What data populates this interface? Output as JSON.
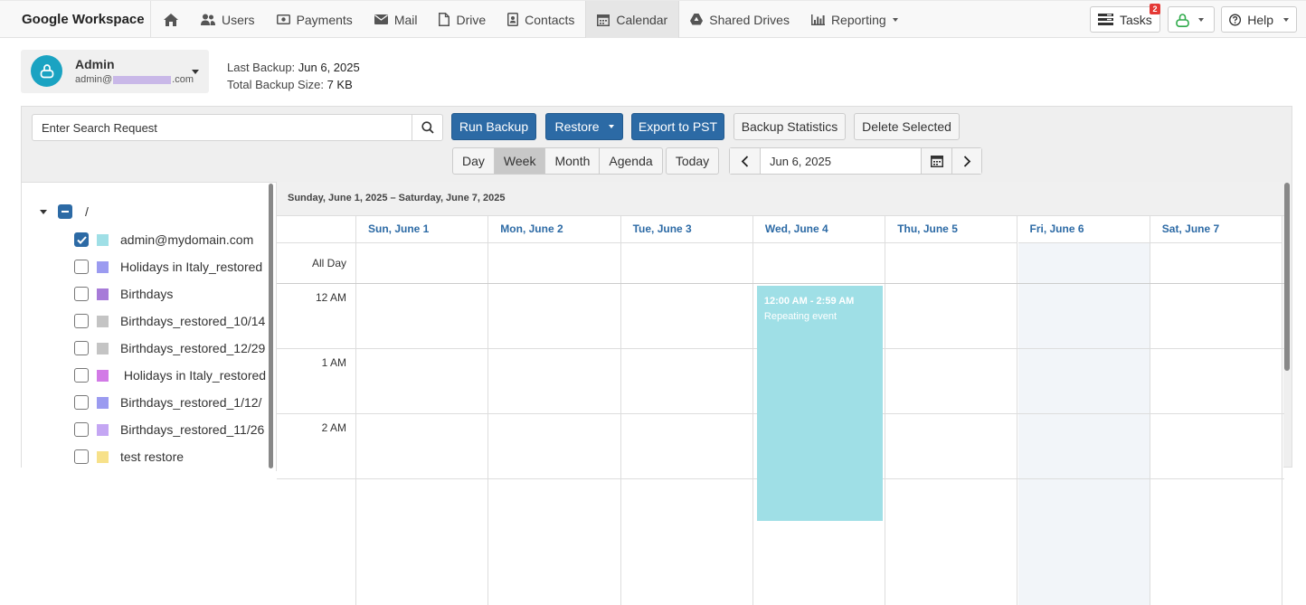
{
  "nav": {
    "brand": "Google Workspace",
    "items": [
      {
        "label": "",
        "icon": "home-icon"
      },
      {
        "label": "Users",
        "icon": "users-icon"
      },
      {
        "label": "Payments",
        "icon": "payments-icon"
      },
      {
        "label": "Mail",
        "icon": "mail-icon"
      },
      {
        "label": "Drive",
        "icon": "drive-icon"
      },
      {
        "label": "Contacts",
        "icon": "contacts-icon"
      },
      {
        "label": "Calendar",
        "icon": "calendar-icon",
        "active": true
      },
      {
        "label": "Shared Drives",
        "icon": "shared-drives-icon"
      },
      {
        "label": "Reporting",
        "icon": "reporting-icon"
      }
    ],
    "tasks_label": "Tasks",
    "tasks_badge": "2",
    "help_label": "Help"
  },
  "account": {
    "name": "Admin",
    "email_prefix": "admin@",
    "email_suffix": ".com",
    "last_backup_label": "Last Backup:",
    "last_backup_value": "Jun 6, 2025",
    "total_size_label": "Total Backup Size:",
    "total_size_value": "7 KB"
  },
  "toolbar": {
    "search_placeholder": "Enter Search Request",
    "run_backup": "Run Backup",
    "restore": "Restore",
    "export_pst": "Export to PST",
    "backup_statistics": "Backup Statistics",
    "delete_selected": "Delete Selected",
    "views": [
      "Day",
      "Week",
      "Month",
      "Agenda"
    ],
    "active_view": "Week",
    "today": "Today",
    "date_value": "Jun 6, 2025"
  },
  "tree": {
    "root_label": "/",
    "items": [
      {
        "label": "admin@mydomain.com",
        "color": "#9fdfe6",
        "checked": true
      },
      {
        "label": "Holidays in Italy_restored",
        "color": "#9b9bf0",
        "checked": false
      },
      {
        "label": "Birthdays",
        "color": "#a77bd8",
        "checked": false
      },
      {
        "label": "Birthdays_restored_10/14",
        "color": "#c4c4c4",
        "checked": false
      },
      {
        "label": "Birthdays_restored_12/29",
        "color": "#c4c4c4",
        "checked": false
      },
      {
        "label": " Holidays in Italy_restored",
        "color": "#d27ae6",
        "checked": false
      },
      {
        "label": "Birthdays_restored_1/12/",
        "color": "#9b9bf0",
        "checked": false
      },
      {
        "label": "Birthdays_restored_11/26",
        "color": "#c4a6f3",
        "checked": false
      },
      {
        "label": "test restore",
        "color": "#f7e18a",
        "checked": false
      }
    ]
  },
  "calendar": {
    "range_title": "Sunday, June 1, 2025 – Saturday, June 7, 2025",
    "days": [
      "Sun, June 1",
      "Mon, June 2",
      "Tue, June 3",
      "Wed, June 4",
      "Thu, June 5",
      "Fri, June 6",
      "Sat, June 7"
    ],
    "today_index": 5,
    "all_day_label": "All Day",
    "hours": [
      "12 AM",
      "1 AM",
      "2 AM"
    ],
    "event": {
      "time": "12:00 AM - 2:59 AM",
      "title": "Repeating event",
      "day_index": 3,
      "color": "#9fdfe6"
    }
  }
}
